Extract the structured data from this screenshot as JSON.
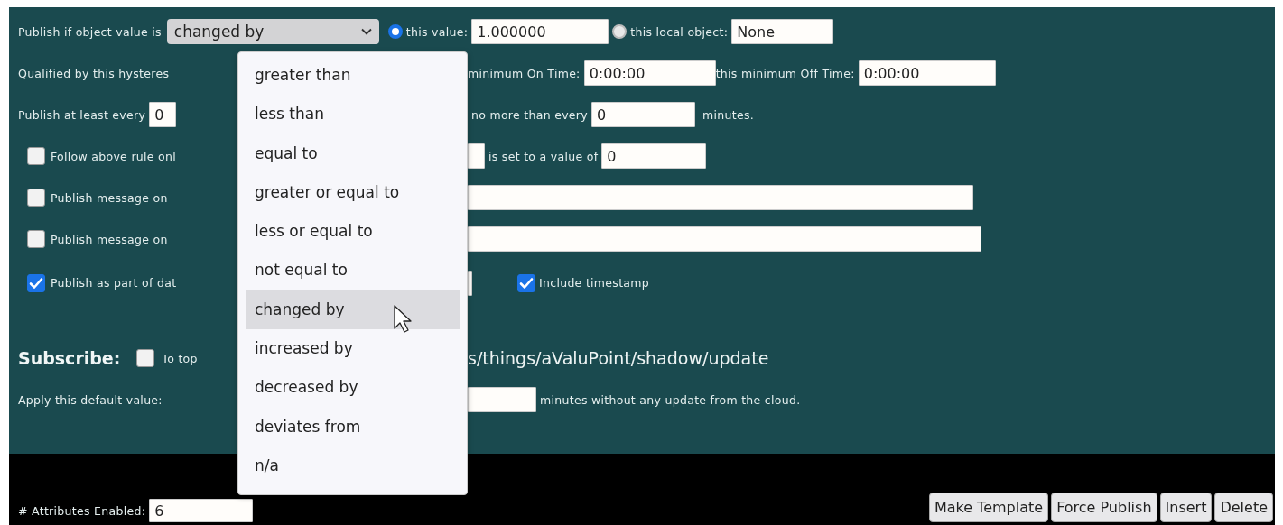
{
  "publish_if": {
    "label": "Publish if object value is",
    "selected_option": "changed by",
    "this_value": {
      "label": "this value:",
      "selected": true,
      "value": "1.000000"
    },
    "local_object": {
      "label": "this local object:",
      "selected": false,
      "value": "None"
    }
  },
  "hysteresis": {
    "label": "Qualified by this hysteres",
    "on_label": "minimum On Time:",
    "on_value": "0:00:00",
    "off_label": "this minimum Off Time:",
    "off_value": "0:00:00"
  },
  "publish_every": {
    "label": "Publish at least every",
    "min_value": "0",
    "max_label": "no more than every",
    "max_value": "0",
    "unit": "minutes."
  },
  "follow_rule": {
    "checked": false,
    "label": "Follow above rule onl",
    "set_label": "is set to a value of",
    "set_value": "0"
  },
  "publish_messages": [
    {
      "checked": false,
      "label": "Publish message on"
    },
    {
      "checked": false,
      "label": "Publish message on"
    }
  ],
  "publish_data": {
    "checked": true,
    "label": "Publish as part of dat",
    "timestamp": {
      "checked": true,
      "label": "Include timestamp"
    }
  },
  "subscribe": {
    "title": "Subscribe:",
    "checked": false,
    "label": "To top",
    "topic": "s/things/aValuPoint/shadow/update"
  },
  "default_value": {
    "label": "Apply this default value:",
    "unit": "minutes without any update from the cloud."
  },
  "footer": {
    "attributes_label": "# Attributes Enabled:",
    "attributes_value": "6",
    "buttons": [
      "Make Template",
      "Force Publish",
      "Insert",
      "Delete"
    ]
  },
  "dropdown": {
    "options": [
      {
        "label": "greater than",
        "selected": false
      },
      {
        "label": "less than",
        "selected": false
      },
      {
        "label": "equal to",
        "selected": false
      },
      {
        "label": "greater or equal to",
        "selected": false
      },
      {
        "label": "less or equal to",
        "selected": false
      },
      {
        "label": "not equal to",
        "selected": false
      },
      {
        "label": "changed by",
        "selected": true
      },
      {
        "label": "increased by",
        "selected": false
      },
      {
        "label": "decreased by",
        "selected": false
      },
      {
        "label": "deviates from",
        "selected": false
      },
      {
        "label": "n/a",
        "selected": false
      }
    ]
  }
}
